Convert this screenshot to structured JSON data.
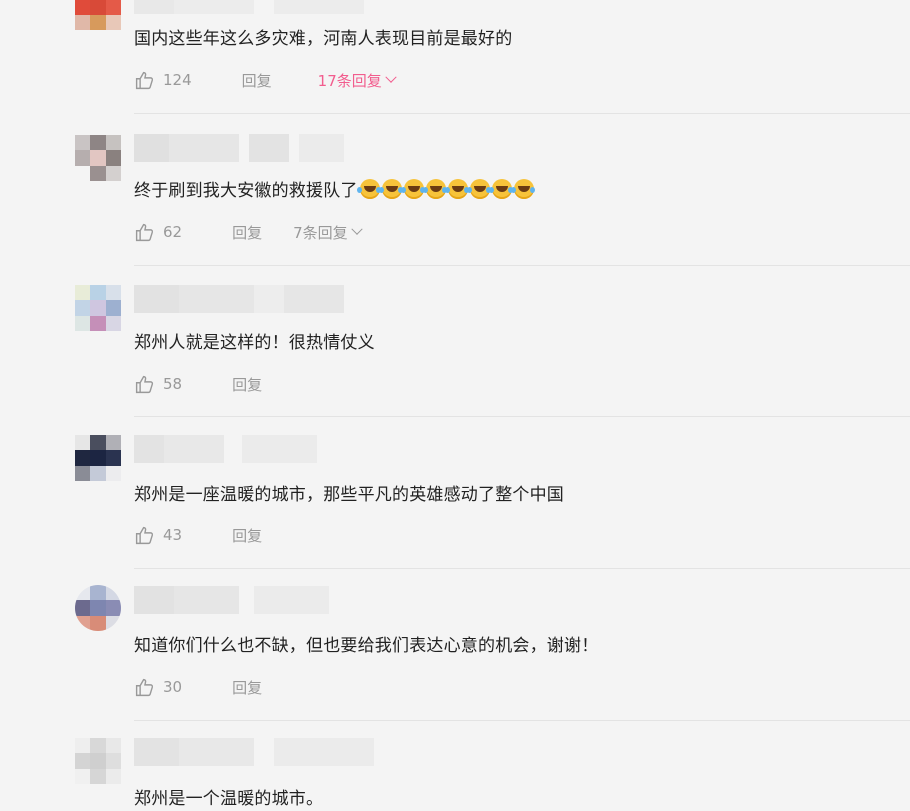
{
  "comments": [
    {
      "text": "国内这些年这么多灾难，河南人表现目前是最好的",
      "likes": "124",
      "reply_label": "回复",
      "more_replies": "17条回复",
      "more_color": "#f25d8e"
    },
    {
      "text": "终于刷到我大安徽的救援队了",
      "emoji_icon": "rofl-emoji-icon",
      "emoji_count": 8,
      "likes": "62",
      "reply_label": "回复",
      "more_replies": "7条回复",
      "more_color": "#999999"
    },
    {
      "text": "郑州人就是这样的！很热情仗义",
      "likes": "58",
      "reply_label": "回复"
    },
    {
      "text": "郑州是一座温暖的城市，那些平凡的英雄感动了整个中国",
      "likes": "43",
      "reply_label": "回复"
    },
    {
      "text": "知道你们什么也不缺，但也要给我们表达心意的机会，谢谢！",
      "likes": "30",
      "reply_label": "回复"
    },
    {
      "text": "郑州是一个温暖的城市。"
    }
  ],
  "colors": {
    "background": "#f4f4f4",
    "text": "#222222",
    "muted": "#999999",
    "accent": "#f25d8e",
    "divider": "#e3e3e3"
  },
  "icons": {
    "like": "thumbs-up-icon",
    "expand": "chevron-down-icon",
    "avatar": "pixelated-avatar"
  }
}
